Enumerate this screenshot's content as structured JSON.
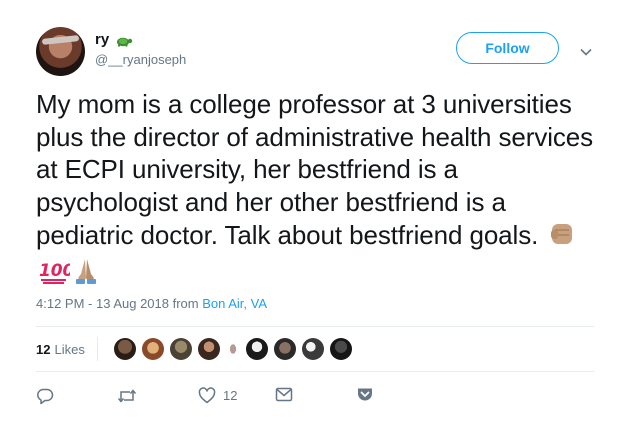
{
  "user": {
    "display_name": "ry",
    "handle": "@__ryanjoseph",
    "badge_icon": "turtle-icon"
  },
  "follow_label": "Follow",
  "tweet": {
    "text": "My mom is a college professor at 3 universities plus the director of administrative health services at ECPI university, her bestfriend is a psychologist and her other bestfriend is a pediatric doctor. Talk about bestfriend goals.",
    "emojis": [
      "raised-fist-icon",
      "hundred-points-icon",
      "folded-hands-icon"
    ]
  },
  "meta": {
    "timestamp": "4:12 PM - 13 Aug 2018 from ",
    "location": "Bon Air, VA"
  },
  "likes": {
    "count": "12",
    "label": "Likes"
  },
  "actions": {
    "like_count": "12"
  },
  "colors": {
    "accent": "#1da1f2",
    "muted": "#657786",
    "text": "#14171a",
    "divider": "#e6ecf0"
  }
}
